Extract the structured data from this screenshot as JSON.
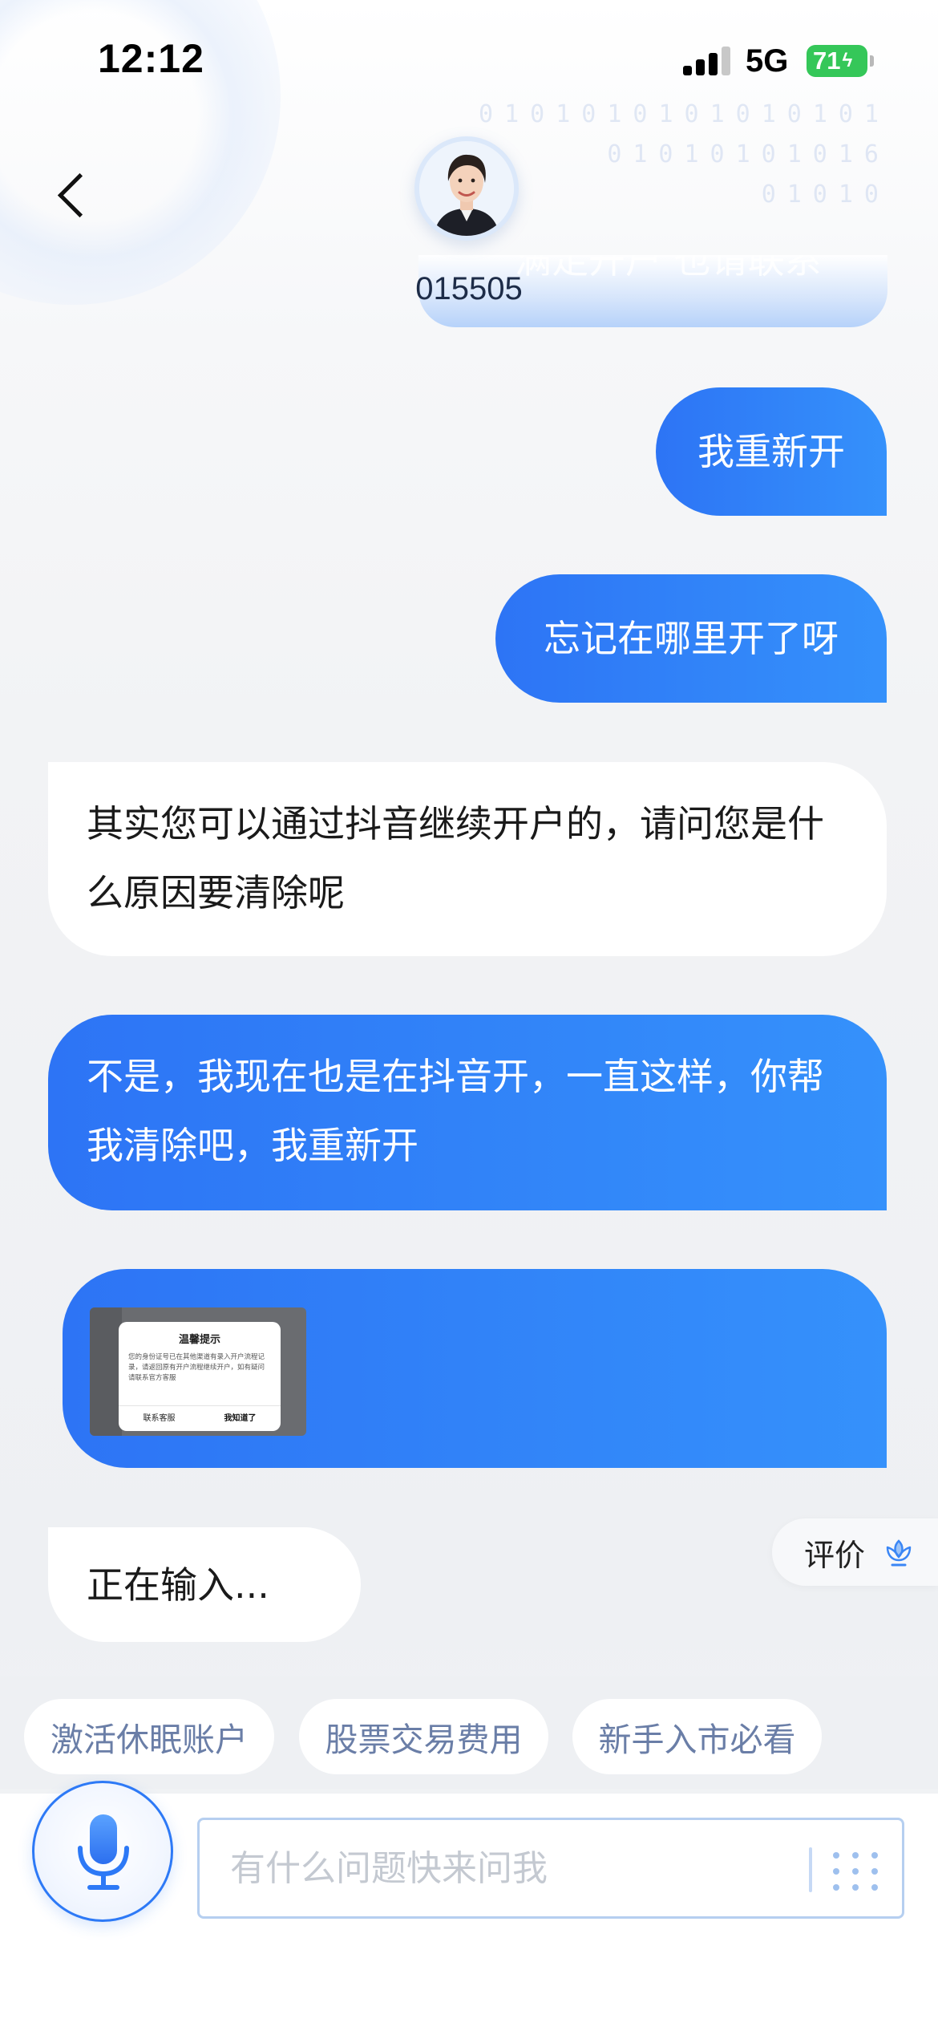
{
  "status_bar": {
    "time": "12:12",
    "network": "5G",
    "battery": "71"
  },
  "header": {
    "agent_id": "015505"
  },
  "previous_bubble_text": "满足开户 也请联系",
  "messages": [
    {
      "from": "user",
      "text": "我重新开"
    },
    {
      "from": "user",
      "text": "忘记在哪里开了呀"
    },
    {
      "from": "agent",
      "text": "其实您可以通过抖音继续开户的，请问您是什么原因要清除呢"
    },
    {
      "from": "user",
      "text": "不是，我现在也是在抖音开，一直这样，你帮我清除吧，我重新开"
    },
    {
      "from": "user",
      "type": "image",
      "image": {
        "title": "温馨提示",
        "body": "您的身份证号已在其他渠道有录入开户流程记录，请返回原有开户流程继续开户，如有疑问请联系官方客服",
        "left_button": "联系客服",
        "right_button": "我知道了"
      }
    },
    {
      "from": "agent",
      "text": "正在输入..."
    }
  ],
  "rate_button": {
    "label": "评价"
  },
  "quick_replies": [
    "激活休眠账户",
    "股票交易费用",
    "新手入市必看"
  ],
  "input": {
    "placeholder": "有什么问题快来问我"
  },
  "colors": {
    "accent": "#2d74f5",
    "accent_light": "#3591fb",
    "chip_text": "#6a7ea7",
    "battery": "#35c759"
  },
  "icons": [
    "back-icon",
    "microphone-icon",
    "keypad-icon",
    "rate-flower-icon",
    "signal-icon",
    "battery-icon"
  ]
}
